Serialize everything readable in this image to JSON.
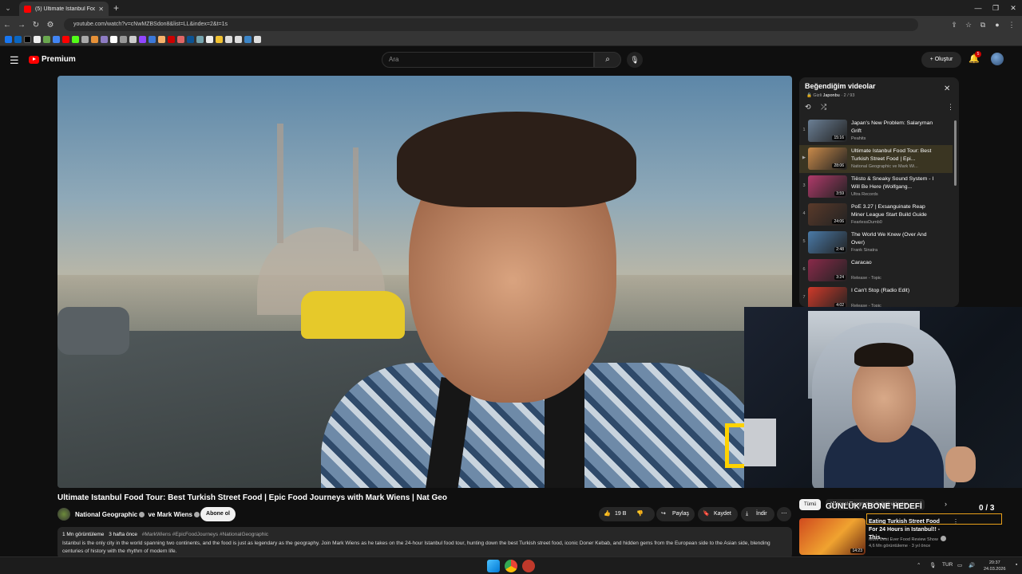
{
  "browser": {
    "tab_title": "(5) Ultimate Istanbul Food",
    "url": "youtube.com/watch?v=cNwMZBSdon8&list=LL&index=2&t=1s"
  },
  "header": {
    "search_placeholder": "Ara",
    "create_label": "Oluştur",
    "notification_count": "5"
  },
  "video": {
    "title": "Ultimate Istanbul Food Tour: Best Turkish Street Food | Epic Food Journeys with Mark Wiens | Nat Geo",
    "channel": "National Geographic",
    "collab": "ve Mark Wiens",
    "subscribe_label": "Abone ol",
    "likes": "19 B",
    "share_label": "Paylaş",
    "save_label": "Kaydet",
    "download_label": "İndir",
    "views": "1 Mn görüntüleme",
    "age": "3 hafta önce",
    "hashtags": "#MarkWiens #EpicFoodJourneys #NationalGeographic",
    "description": "Istanbul is the only city in the world spanning two continents, and the food is just as legendary as the geography. Join Mark Wiens as he takes on the 24-hour Istanbul food tour, hunting down the best Turkish street food, iconic Doner Kebab, and hidden gems from the European side to the Asian side, blending centuries of history with the rhythm of modern life."
  },
  "playlist": {
    "title": "Beğendiğim videolar",
    "privacy": "Gizli",
    "owner": "Japonbu",
    "position": "2 / 93",
    "items": [
      {
        "index": "1",
        "title": "Japan's New Problem: Salaryman Grift",
        "channel": "Peahits",
        "duration": "15:16",
        "color": "#6b7f95"
      },
      {
        "index": "▶",
        "title": "Ultimate Istanbul Food Tour: Best Turkish Street Food | Epi...",
        "channel": "National Geographic ve Mark Wi...",
        "duration": "28:06",
        "color": "#c98a4a"
      },
      {
        "index": "3",
        "title": "Tiësto & Sneaky Sound System - I Will Be Here (Wolfgang...",
        "channel": "Ultra Records",
        "duration": "3:59",
        "color": "#b03a6a"
      },
      {
        "index": "4",
        "title": "PoE 3.27 | Exsanguinate Reap Miner League Start Build Guide",
        "channel": "FearlessDumb0",
        "duration": "24:06",
        "color": "#5a3a2a"
      },
      {
        "index": "5",
        "title": "The World We Knew (Over And Over)",
        "channel": "Frank Sinatra",
        "duration": "2:48",
        "color": "#4a7aa8"
      },
      {
        "index": "6",
        "title": "Caracao",
        "channel": "Release - Topic",
        "duration": "3:24",
        "color": "#8a2a4a"
      },
      {
        "index": "7",
        "title": "I Can't Stop (Radio Edit)",
        "channel": "Release - Topic",
        "duration": "4:02",
        "color": "#d03a2a"
      }
    ]
  },
  "recommendations": {
    "chip_all": "Tümü",
    "chip_second": "National Geographic ile ilgili videolar",
    "overlay_goal": "GÜNLÜK ABONE HEDEFİ",
    "overlay_count": "0 / 3",
    "item": {
      "title": "Eating Turkish Street Food For 24 Hours in Istanbul!! - This ...",
      "channel": "More Best Ever Food Review Show",
      "meta": "4,6 Mn görüntüleme · 3 yıl önce",
      "duration": "14:23"
    }
  },
  "taskbar": {
    "language": "TUR",
    "time": "20:37",
    "date": "24.03.2026"
  }
}
